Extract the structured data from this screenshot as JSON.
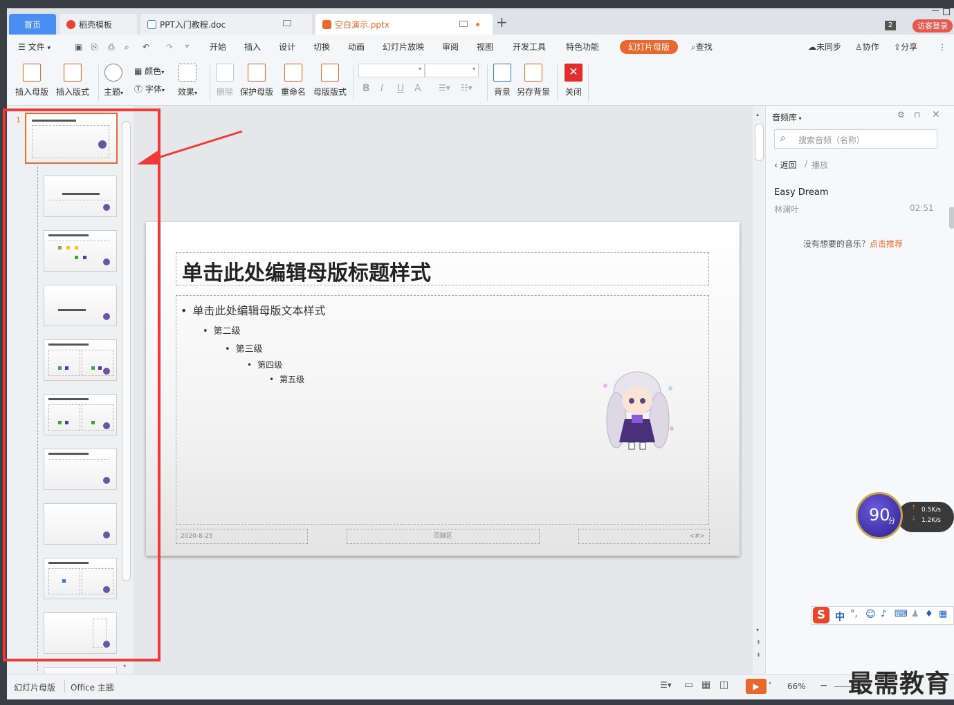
{
  "tabs": {
    "home": "首页",
    "daoke": "稻壳模板",
    "doc": "PPT入门教程.doc",
    "pptx": "空白演示.pptx",
    "badge": "2",
    "visitor": "访客登录"
  },
  "menu": {
    "file": "文件",
    "items": [
      "开始",
      "插入",
      "设计",
      "切换",
      "动画",
      "幻灯片放映",
      "审阅",
      "视图",
      "开发工具",
      "特色功能"
    ],
    "active": "幻灯片母版",
    "search": "查找",
    "sync": "未同步",
    "collab": "协作",
    "share": "分享"
  },
  "ribbon": {
    "insert_master": "插入母版",
    "insert_layout": "插入版式",
    "theme": "主题",
    "color": "颜色",
    "font": "字体",
    "effect": "效果",
    "delete": "删除",
    "protect_master": "保护母版",
    "rename": "重命名",
    "master_layout": "母版版式",
    "bold": "B",
    "italic": "I",
    "underline": "U",
    "fontcolor": "A",
    "background": "背景",
    "save_background": "另存背景",
    "close": "关闭"
  },
  "thumbnails": {
    "master_number": "1"
  },
  "slide": {
    "title": "单击此处编辑母版标题样式",
    "level1": "单击此处编辑母版文本样式",
    "level2": "第二级",
    "level3": "第三级",
    "level4": "第四级",
    "level5": "第五级",
    "date": "2020-8-25",
    "footer": "页脚区",
    "number": "<#>"
  },
  "side": {
    "title": "音频库",
    "search_placeholder": "搜索音频（名称）",
    "back": "返回",
    "slash": "/",
    "play": "播放",
    "song": "Easy Dream",
    "artist": "林澜叶",
    "duration": "02:51",
    "no_music": "没有想要的音乐？",
    "recommend": "点击推荐"
  },
  "speed": {
    "score": "90",
    "unit": "分",
    "up": "0.5K/s",
    "down": "1.2K/s"
  },
  "ime": {
    "lang": "中"
  },
  "status": {
    "mode": "幻灯片母版",
    "theme": "Office 主题",
    "zoom": "66%"
  },
  "watermark": "最需教育",
  "colors": {
    "accent": "#e8682d",
    "active_tab": "#4b8ef1",
    "annotation": "#ee3a3a",
    "visitor": "#e45a4e"
  }
}
